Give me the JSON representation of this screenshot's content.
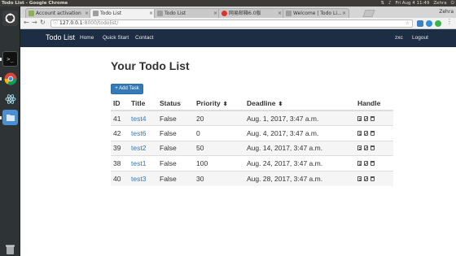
{
  "os": {
    "window_title": "Todo List - Google Chrome",
    "time": "Fri Aug 4 11:49",
    "user": "Zehra"
  },
  "browser": {
    "tabs": [
      {
        "label": "Account activation",
        "active": false,
        "fav_color": "#8ab34b"
      },
      {
        "label": "Todo List",
        "active": true,
        "fav_color": "#9e9e9e"
      },
      {
        "label": "Todo List",
        "active": false,
        "fav_color": "#9e9e9e"
      },
      {
        "label": "网易邮箱6.0版",
        "active": false,
        "fav_color": "#d9332b"
      },
      {
        "label": "Welcome | Todo Li...",
        "active": false,
        "fav_color": "#9e9e9e"
      }
    ],
    "url_host": "127.0.0.1",
    "url_path": ":8000/todolist/",
    "accent_color": "#337ab7"
  },
  "navbar": {
    "brand": "Todo List",
    "links": [
      "Home",
      "Quick Start",
      "Contact"
    ],
    "user": "zxc",
    "logout": "Logout",
    "bg_color": "#1d2e44"
  },
  "main": {
    "title": "Your Todo List",
    "add_button": "+ Add Task",
    "table": {
      "headers": [
        "ID",
        "Title",
        "Status",
        "Priority",
        "Deadline",
        "Handle"
      ],
      "rows": [
        [
          "41",
          "test4",
          "False",
          "20",
          "Aug. 1, 2017, 3:47 a.m."
        ],
        [
          "42",
          "test6",
          "False",
          "0",
          "Aug. 4, 2017, 3:47 a.m."
        ],
        [
          "39",
          "test2",
          "False",
          "50",
          "Aug. 14, 2017, 3:47 a.m."
        ],
        [
          "38",
          "test1",
          "False",
          "100",
          "Aug. 24, 2017, 3:47 a.m."
        ],
        [
          "40",
          "test3",
          "False",
          "30",
          "Aug. 28, 2017, 3:47 a.m."
        ]
      ]
    }
  },
  "icons": {
    "sort": "sort-icon",
    "detail": "detail-icon",
    "edit": "edit-icon",
    "delete": "trash-icon"
  }
}
